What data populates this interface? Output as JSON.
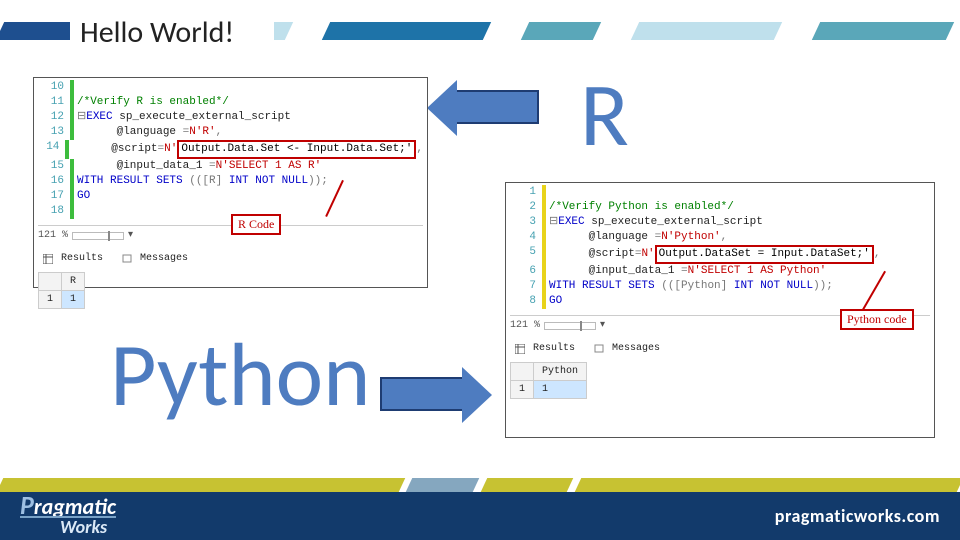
{
  "title": "Hello World!",
  "labels": {
    "r": "R",
    "python": "Python"
  },
  "callouts": {
    "r_code": "R Code",
    "py_code": "Python code"
  },
  "panel_r": {
    "rows": [
      {
        "n": "10",
        "cls": "",
        "txt": ""
      },
      {
        "n": "11",
        "cls": "cm",
        "txt": "/*Verify R is enabled*/"
      },
      {
        "n": "12",
        "cls": "",
        "html": "<span class='sk'>⊟</span><span class='kw'>EXEC</span> sp_execute_external_script"
      },
      {
        "n": "13",
        "cls": "",
        "html": "      @language <span class='sk'>=</span><span class='str'>N'R'</span><span class='sk'>,</span>"
      },
      {
        "n": "14",
        "cls": "",
        "html": "      @script<span class='sk'>=</span><span class='str'>N'</span><span class='box-r'>Output.Data.Set &lt;- Input.Data.Set;'</span><span class='sk'>,</span>"
      },
      {
        "n": "15",
        "cls": "",
        "html": "      @input_data_1 <span class='sk'>=</span><span class='str'>N'SELECT 1 AS R'</span>"
      },
      {
        "n": "16",
        "cls": "",
        "html": "<span class='kw'>WITH RESULT SETS</span> <span class='sk'>(([R] </span><span class='kw'>INT NOT NULL</span><span class='sk'>));</span>"
      },
      {
        "n": "17",
        "cls": "kw",
        "txt": "GO"
      },
      {
        "n": "18",
        "cls": "",
        "txt": ""
      }
    ],
    "zoom": "121 %",
    "tabs": {
      "results": "Results",
      "messages": "Messages"
    },
    "grid": {
      "header": "R",
      "row": "1",
      "val": "1"
    }
  },
  "panel_py": {
    "rows": [
      {
        "n": "1",
        "cls": "",
        "txt": ""
      },
      {
        "n": "2",
        "cls": "cm",
        "txt": "/*Verify Python is enabled*/"
      },
      {
        "n": "3",
        "cls": "",
        "html": "<span class='sk'>⊟</span><span class='kw'>EXEC</span> sp_execute_external_script"
      },
      {
        "n": "4",
        "cls": "",
        "html": "      @language <span class='sk'>=</span><span class='str'>N'Python'</span><span class='sk'>,</span>"
      },
      {
        "n": "5",
        "cls": "",
        "html": "      @script<span class='sk'>=</span><span class='str'>N'</span><span class='box-r'>Output.DataSet = Input.DataSet;'</span><span class='sk'>,</span>"
      },
      {
        "n": "6",
        "cls": "",
        "html": "      @input_data_1 <span class='sk'>=</span><span class='str'>N'SELECT 1 AS Python'</span>"
      },
      {
        "n": "7",
        "cls": "",
        "html": "<span class='kw'>WITH RESULT SETS</span> <span class='sk'>(([Python] </span><span class='kw'>INT NOT NULL</span><span class='sk'>));</span>"
      },
      {
        "n": "8",
        "cls": "kw",
        "txt": "GO"
      }
    ],
    "zoom": "121 %",
    "tabs": {
      "results": "Results",
      "messages": "Messages"
    },
    "grid": {
      "header": "Python",
      "row": "1",
      "val": "1"
    }
  },
  "footer": {
    "brand1": "Pragmatic",
    "brand2": "Works",
    "url": "pragmaticworks.com"
  }
}
